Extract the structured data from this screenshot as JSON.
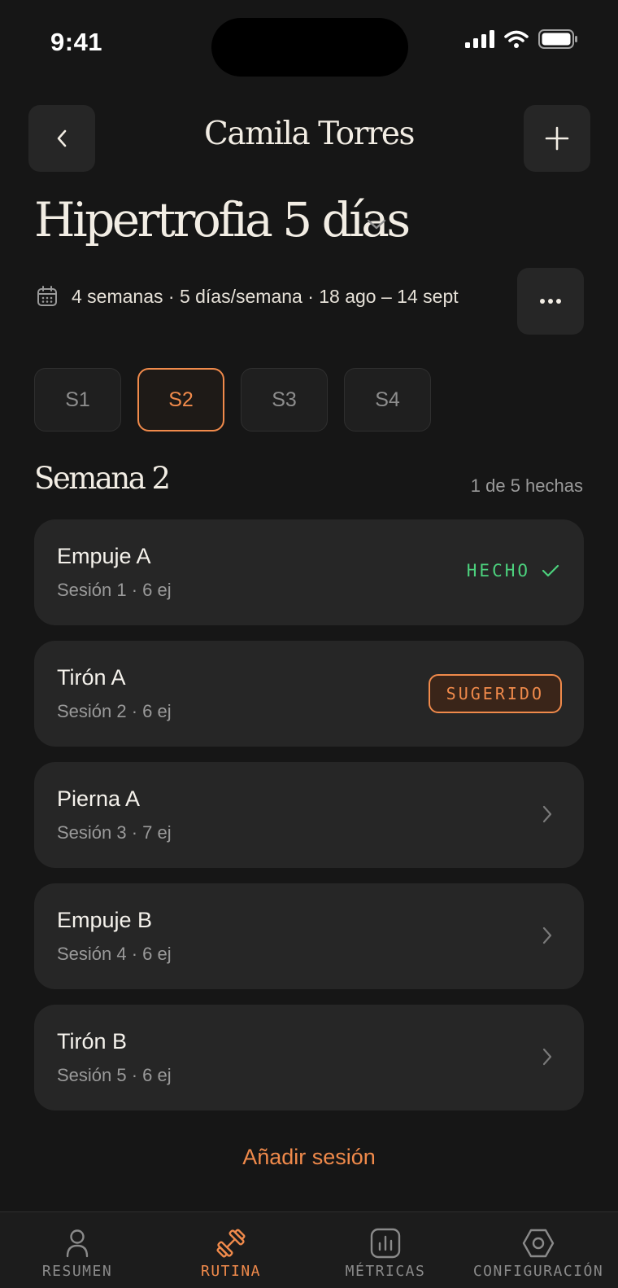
{
  "status_bar": {
    "time": "9:41"
  },
  "header": {
    "title": "Camila Torres",
    "back_icon": "chevron-left-icon",
    "add_icon": "plus-icon"
  },
  "routine": {
    "title": "Hipertrofia 5 días",
    "meta": "4 semanas · 5 días/semana · 18 ago – 14 sept"
  },
  "weeks": [
    {
      "label": "S1",
      "active": false
    },
    {
      "label": "S2",
      "active": true
    },
    {
      "label": "S3",
      "active": false
    },
    {
      "label": "S4",
      "active": false
    }
  ],
  "week_section": {
    "heading": "Semana 2",
    "progress": "1 de 5 hechas"
  },
  "sessions": [
    {
      "name": "Empuje A",
      "sub": "Sesión 1 · 6 ej",
      "status": "HECHO"
    },
    {
      "name": "Tirón A",
      "sub": "Sesión 2 · 6 ej",
      "status": "SUGERIDO"
    },
    {
      "name": "Pierna A",
      "sub": "Sesión 3 · 7 ej"
    },
    {
      "name": "Empuje B",
      "sub": "Sesión 4 · 6 ej"
    },
    {
      "name": "Tirón B",
      "sub": "Sesión 5 · 6 ej"
    }
  ],
  "add_session_label": "Añadir sesión",
  "tabs": [
    {
      "label": "RESUMEN",
      "icon": "person-icon",
      "active": false
    },
    {
      "label": "RUTINA",
      "icon": "dumbbell-icon",
      "active": true
    },
    {
      "label": "MÉTRICAS",
      "icon": "bar-chart-icon",
      "active": false
    },
    {
      "label": "CONFIGURACIÓN",
      "icon": "settings-icon",
      "active": false
    }
  ],
  "colors": {
    "background": "#161616",
    "card": "#262626",
    "accent": "#f08a4b",
    "success": "#4cd17d",
    "text": "#f2ede4",
    "muted": "#9a9a9a"
  }
}
